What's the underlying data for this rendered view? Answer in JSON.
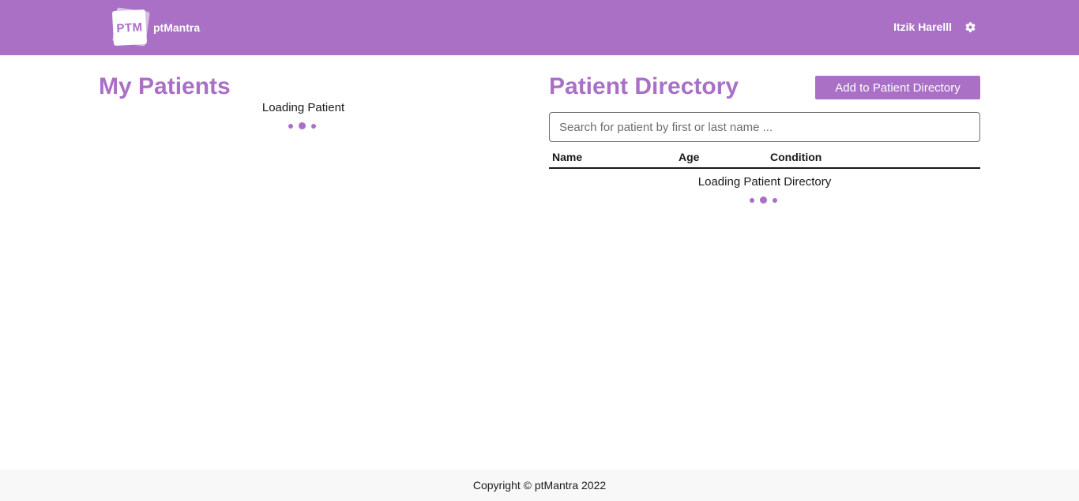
{
  "header": {
    "logo_mark_text": "PTM",
    "logo_text": "ptMantra",
    "user_name": "Itzik Harelll",
    "settings_icon": "gear-icon"
  },
  "my_patients": {
    "title": "My Patients",
    "loading_text": "Loading Patient"
  },
  "directory": {
    "title": "Patient Directory",
    "add_button_label": "Add to Patient Directory",
    "search_placeholder": "Search for patient by first or last name ...",
    "columns": [
      "Name",
      "Age",
      "Condition"
    ],
    "loading_text": "Loading Patient Directory"
  },
  "footer": {
    "copyright": "Copyright © ptMantra 2022"
  },
  "colors": {
    "brand": "#a970c5",
    "footer_bg": "#f8f8f8"
  }
}
